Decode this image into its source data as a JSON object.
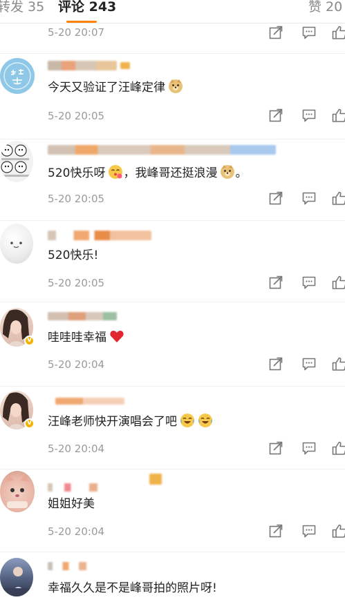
{
  "tabs": {
    "reposts": "转发 35",
    "comments": "评论 243",
    "likes": "赞 20"
  },
  "icons": {
    "share": "share-icon",
    "reply": "comment-icon",
    "like": "thumbs-up-icon"
  },
  "colors": {
    "accent": "#ff8200",
    "muted": "#9a9a9a",
    "vip_badge": "#f5b300"
  },
  "comments": [
    {
      "text": "",
      "time": "5-20 20:07"
    },
    {
      "text": "今天又验证了汪峰定律",
      "time": "5-20 20:05",
      "avatar_text": "如意",
      "emoji": [
        "doge"
      ]
    },
    {
      "text": "520快乐呀",
      "text2": "，我峰哥还挺浪漫",
      "text3": "。",
      "time": "5-20 20:05",
      "emoji": [
        "kiss",
        "doge"
      ]
    },
    {
      "text": "520快乐!",
      "time": "5-20 20:05"
    },
    {
      "text": "哇哇哇幸福",
      "time": "5-20 20:04",
      "emoji": [
        "heart"
      ]
    },
    {
      "text": "汪峰老师快开演唱会了吧",
      "time": "5-20 20:04",
      "emoji": [
        "laugh-cry",
        "laugh-cry"
      ]
    },
    {
      "text": "姐姐好美",
      "time": "5-20 20:04"
    },
    {
      "text": "幸福久久是不是峰哥拍的照片呀!",
      "time": ""
    }
  ]
}
